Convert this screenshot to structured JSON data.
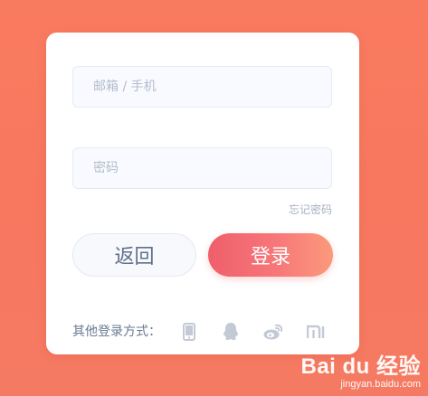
{
  "form": {
    "email_placeholder": "邮箱 / 手机",
    "email_value": "",
    "password_placeholder": "密码",
    "password_value": "",
    "forgot_label": "忘记密码",
    "back_label": "返回",
    "login_label": "登录"
  },
  "social": {
    "label": "其他登录方式：",
    "icons": [
      "phone-icon",
      "qq-icon",
      "weibo-icon",
      "xiaomi-icon"
    ],
    "icon_color": "#c3cad6"
  },
  "watermark": {
    "logo_text": "Bai du 经验",
    "url": "jingyan.baidu.com"
  },
  "colors": {
    "background": "#f87a60",
    "login_gradient_start": "#ef5f6b",
    "login_gradient_end": "#fb9a7b"
  }
}
